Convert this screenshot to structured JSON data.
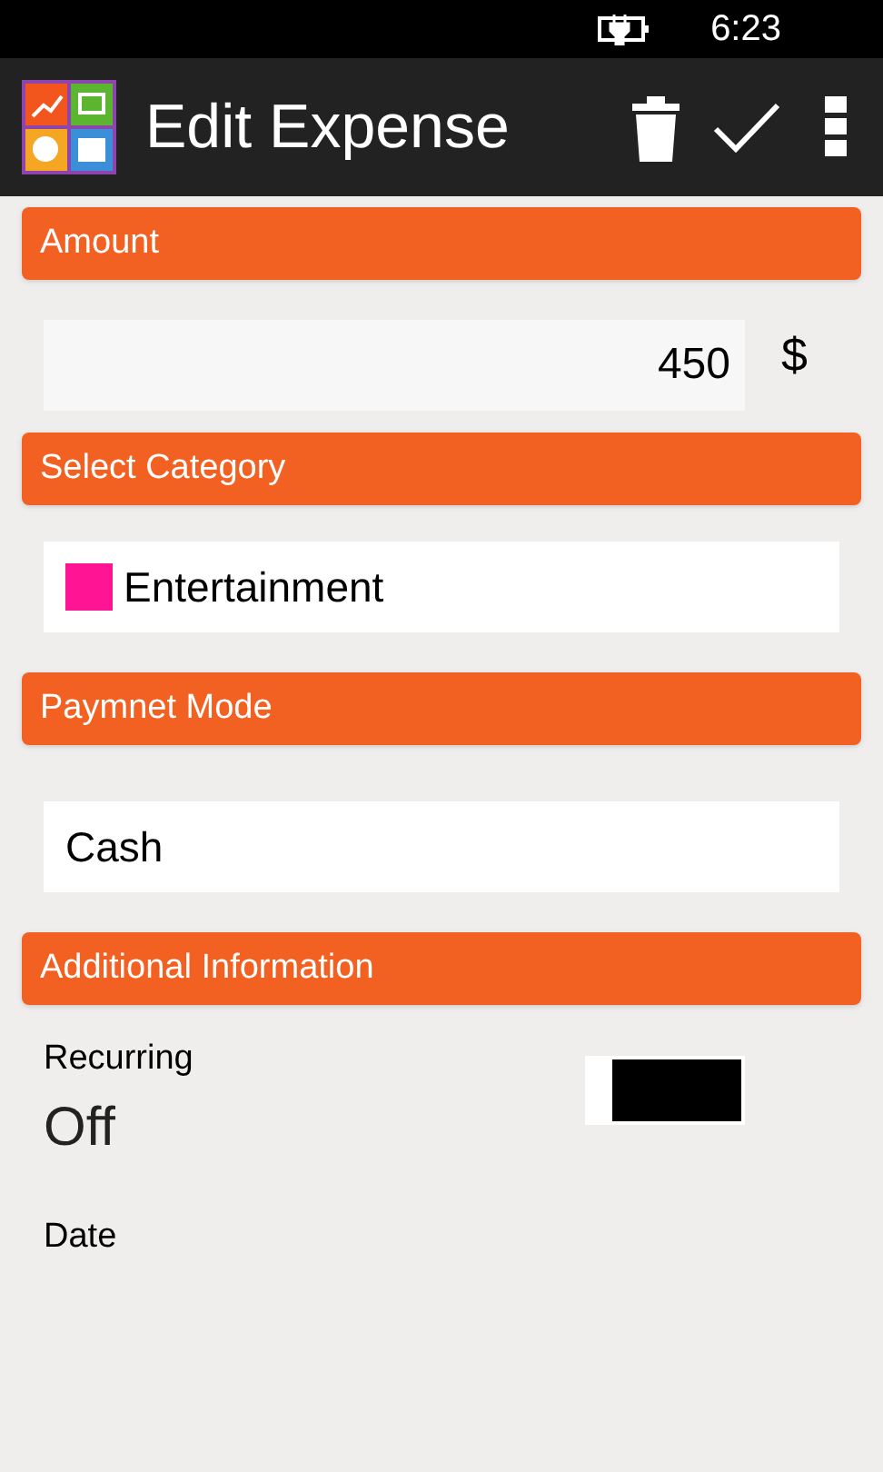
{
  "status_bar": {
    "time": "6:23"
  },
  "app_bar": {
    "title": "Edit Expense"
  },
  "amount": {
    "header": "Amount",
    "value": "450",
    "currency": "$"
  },
  "category": {
    "header": "Select Category",
    "value": "Entertainment",
    "color": "#ff1493"
  },
  "payment": {
    "header": "Paymnet Mode",
    "value": "Cash"
  },
  "additional": {
    "header": "Additional Information"
  },
  "recurring": {
    "label": "Recurring",
    "state": "Off",
    "on": false
  },
  "date": {
    "label": "Date"
  }
}
